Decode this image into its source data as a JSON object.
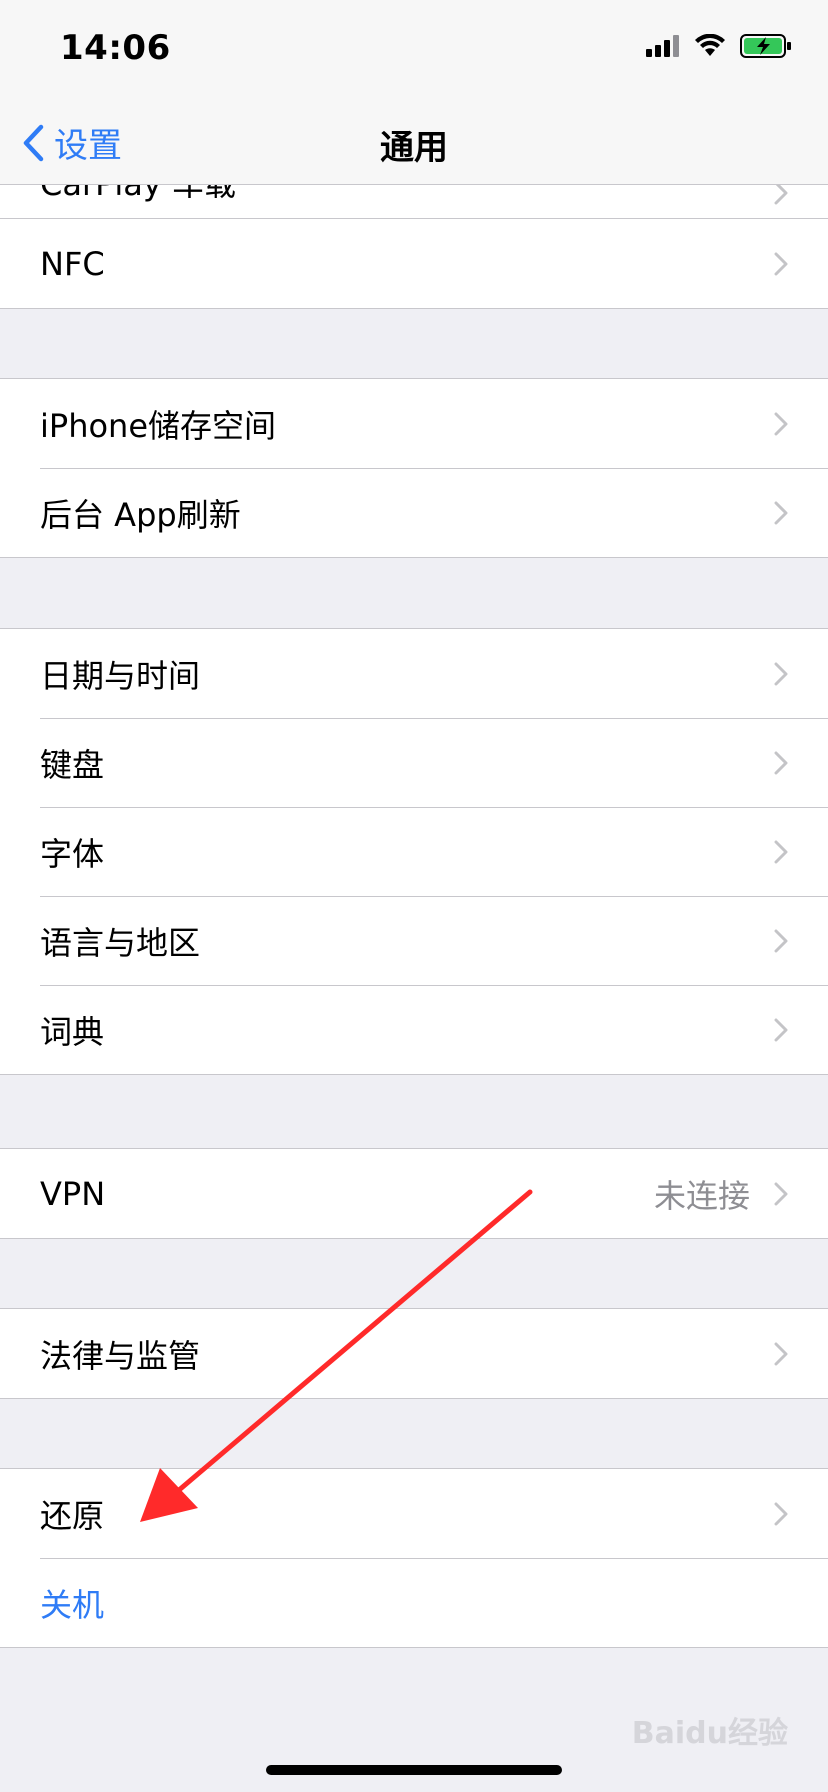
{
  "status_bar": {
    "time": "14:06",
    "icons": [
      "signal-icon",
      "wifi-icon",
      "battery-charging-icon"
    ]
  },
  "nav": {
    "back_label": "设置",
    "title": "通用"
  },
  "partial_row": {
    "label": "CarPlay 车载"
  },
  "groups": [
    {
      "rows": [
        {
          "label": "NFC",
          "value": "",
          "chevron": true
        }
      ]
    },
    {
      "rows": [
        {
          "label": "iPhone储存空间",
          "value": "",
          "chevron": true
        },
        {
          "label": "后台 App刷新",
          "value": "",
          "chevron": true
        }
      ]
    },
    {
      "rows": [
        {
          "label": "日期与时间",
          "value": "",
          "chevron": true
        },
        {
          "label": "键盘",
          "value": "",
          "chevron": true
        },
        {
          "label": "字体",
          "value": "",
          "chevron": true
        },
        {
          "label": "语言与地区",
          "value": "",
          "chevron": true
        },
        {
          "label": "词典",
          "value": "",
          "chevron": true
        }
      ]
    },
    {
      "rows": [
        {
          "label": "VPN",
          "value": "未连接",
          "chevron": true
        }
      ]
    },
    {
      "rows": [
        {
          "label": "法律与监管",
          "value": "",
          "chevron": true
        }
      ]
    },
    {
      "rows": [
        {
          "label": "还原",
          "value": "",
          "chevron": true
        },
        {
          "label": "关机",
          "value": "",
          "chevron": false,
          "style": "blue"
        }
      ]
    }
  ],
  "watermark": "Baidu经验",
  "colors": {
    "accent": "#2f7cf6",
    "background": "#efeff4",
    "separator": "#c8c7cc",
    "secondary_text": "#8e8e93",
    "annotation": "#ff2a2a"
  }
}
